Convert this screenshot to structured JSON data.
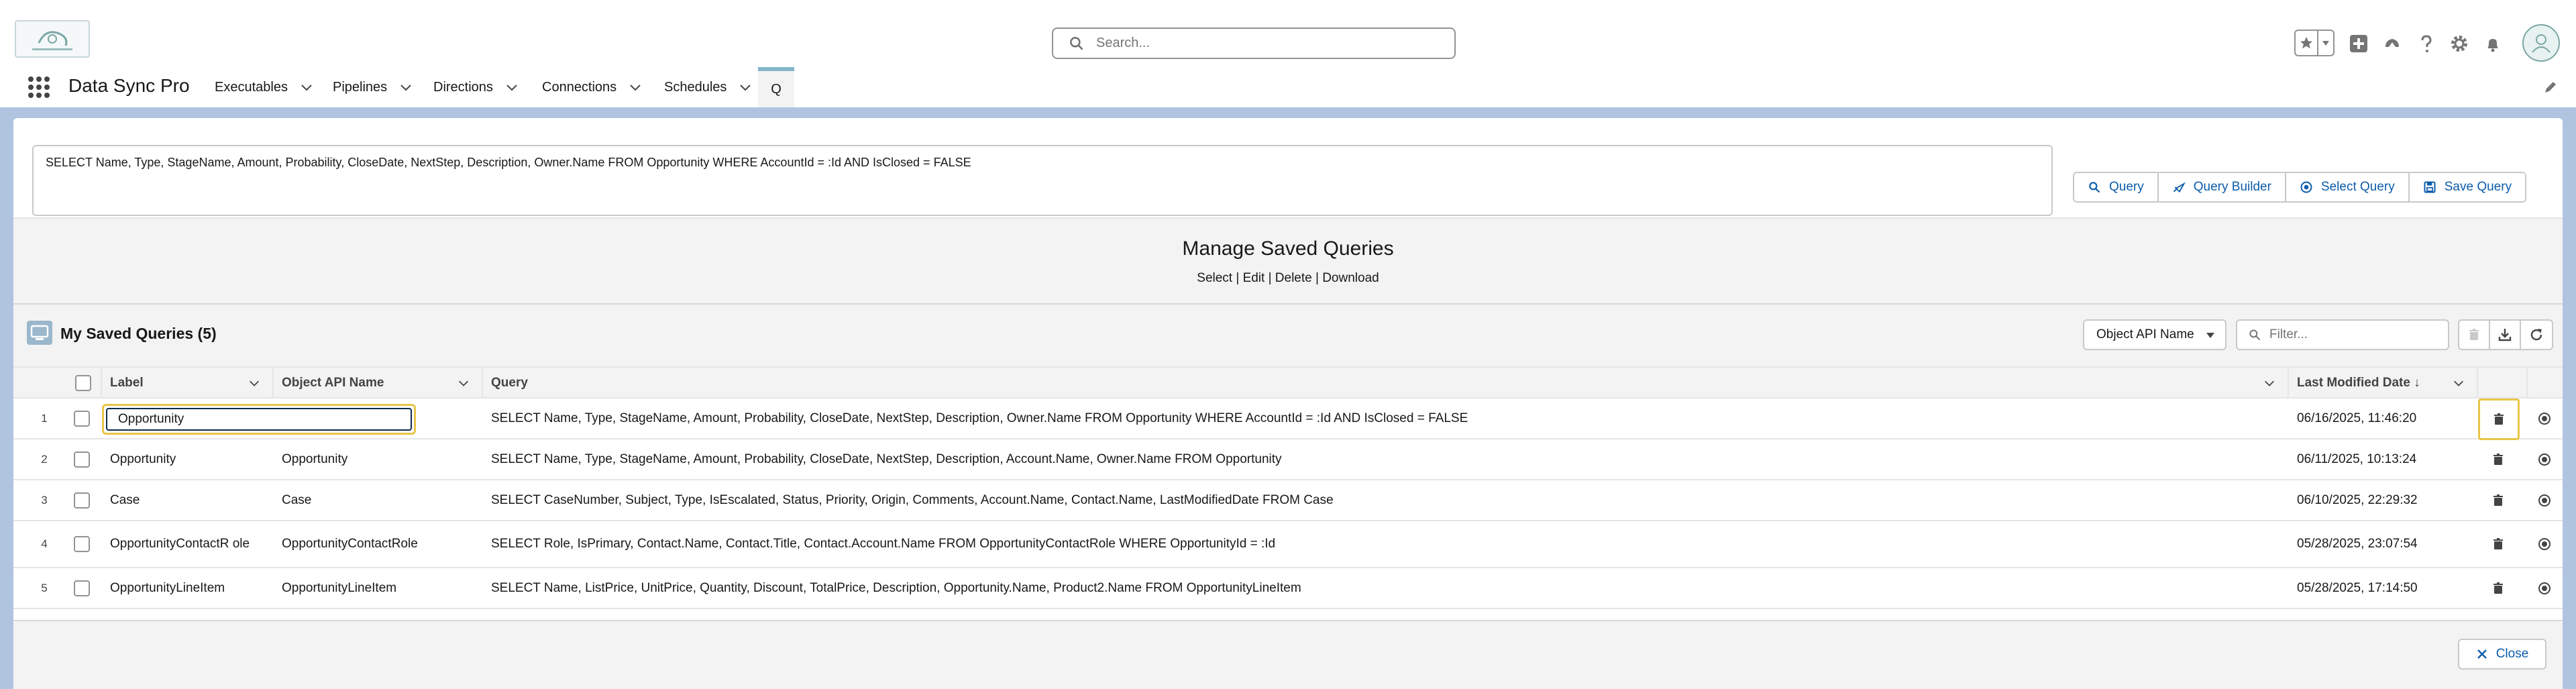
{
  "header": {
    "search_placeholder": "Search...",
    "icons": [
      "favorites-star-icon",
      "favorites-dropdown-icon",
      "add-icon",
      "trailhead-icon",
      "help-icon",
      "setup-gear-icon",
      "notifications-bell-icon",
      "user-avatar"
    ]
  },
  "nav": {
    "app_name": "Data Sync Pro",
    "items": [
      {
        "label": "Executables"
      },
      {
        "label": "Pipelines"
      },
      {
        "label": "Directions"
      },
      {
        "label": "Connections"
      },
      {
        "label": "Schedules"
      }
    ],
    "active_tab": "Q"
  },
  "query_editor": {
    "text": "SELECT Name, Type, StageName, Amount, Probability, CloseDate, NextStep, Description, Owner.Name FROM Opportunity WHERE AccountId = :Id AND IsClosed = FALSE"
  },
  "query_buttons": [
    {
      "label": "Query",
      "icon": "search-icon"
    },
    {
      "label": "Query Builder",
      "icon": "builder-icon"
    },
    {
      "label": "Select Query",
      "icon": "target-icon"
    },
    {
      "label": "Save Query",
      "icon": "save-icon"
    }
  ],
  "modal": {
    "title": "Manage Saved Queries",
    "subtitle": "Select | Edit | Delete | Download",
    "close_label": "Close"
  },
  "card": {
    "title": "My Saved Queries (5)",
    "object_select_value": "Object API Name",
    "filter_placeholder": "Filter..."
  },
  "table": {
    "columns": {
      "label": "Label",
      "object": "Object API Name",
      "query": "Query",
      "modified": "Last Modified Date ↓"
    },
    "rows": [
      {
        "num": "1",
        "label": "Opportunity",
        "object": "",
        "query": "SELECT Name, Type, StageName, Amount, Probability, CloseDate, NextStep, Description, Owner.Name FROM Opportunity WHERE AccountId = :Id AND IsClosed = FALSE",
        "modified": "06/16/2025, 11:46:20",
        "editing": true
      },
      {
        "num": "2",
        "label": "Opportunity",
        "object": "Opportunity",
        "query": "SELECT Name, Type, StageName, Amount, Probability, CloseDate, NextStep, Description, Account.Name, Owner.Name FROM Opportunity",
        "modified": "06/11/2025, 10:13:24"
      },
      {
        "num": "3",
        "label": "Case",
        "object": "Case",
        "query": "SELECT CaseNumber, Subject, Type, IsEscalated, Status, Priority, Origin, Comments, Account.Name, Contact.Name, LastModifiedDate FROM Case",
        "modified": "06/10/2025, 22:29:32"
      },
      {
        "num": "4",
        "label": "OpportunityContactR ole",
        "object": "OpportunityContactRole",
        "query": "SELECT Role, IsPrimary, Contact.Name, Contact.Title, Contact.Account.Name FROM OpportunityContactRole WHERE OpportunityId = :Id",
        "modified": "05/28/2025, 23:07:54"
      },
      {
        "num": "5",
        "label": "OpportunityLineItem",
        "object": "OpportunityLineItem",
        "query": "SELECT Name, ListPrice, UnitPrice, Quantity, Discount, TotalPrice, Description, Opportunity.Name, Product2.Name FROM OpportunityLineItem",
        "modified": "05/28/2025, 17:14:50"
      }
    ]
  }
}
